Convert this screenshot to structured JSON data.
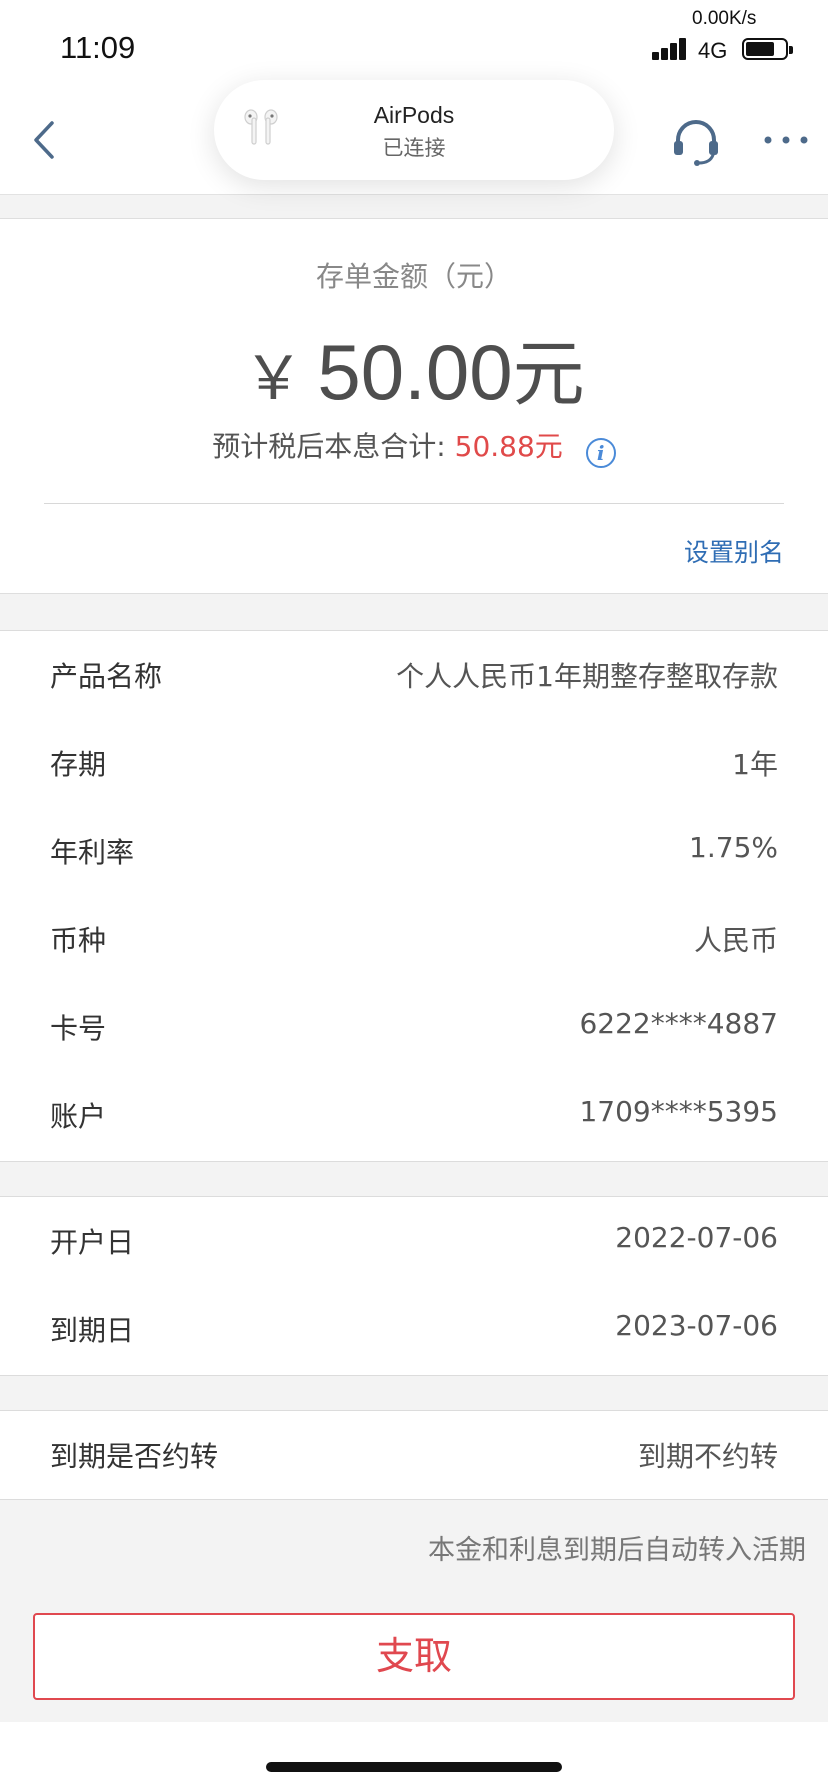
{
  "status_bar": {
    "time": "11:09",
    "net_speed": "0.00K/s",
    "network": "4G"
  },
  "nav": {
    "airpods_name": "AirPods",
    "airpods_status": "已连接"
  },
  "amount": {
    "label": "存单金额（元）",
    "currency_symbol": "￥",
    "value": "50.00",
    "unit": "元",
    "interest_label": "预计税后本息合计:",
    "interest_value": "50.88元",
    "alias_link": "设置别名"
  },
  "details": [
    {
      "label": "产品名称",
      "value": "个人人民币1年期整存整取存款"
    },
    {
      "label": "存期",
      "value": "1年"
    },
    {
      "label": "年利率",
      "value": "1.75%"
    },
    {
      "label": "币种",
      "value": "人民币"
    },
    {
      "label": "卡号",
      "value": "6222****4887"
    },
    {
      "label": "账户",
      "value": "1709****5395"
    }
  ],
  "dates": [
    {
      "label": "开户日",
      "value": "2022-07-06"
    },
    {
      "label": "到期日",
      "value": "2023-07-06"
    }
  ],
  "renewal": {
    "label": "到期是否约转",
    "value": "到期不约转"
  },
  "hint": "本金和利息到期后自动转入活期",
  "withdraw_label": "支取",
  "colors": {
    "accent_red": "#e0484f",
    "link_blue": "#2f6db4",
    "info_blue": "#4a8ad8"
  }
}
